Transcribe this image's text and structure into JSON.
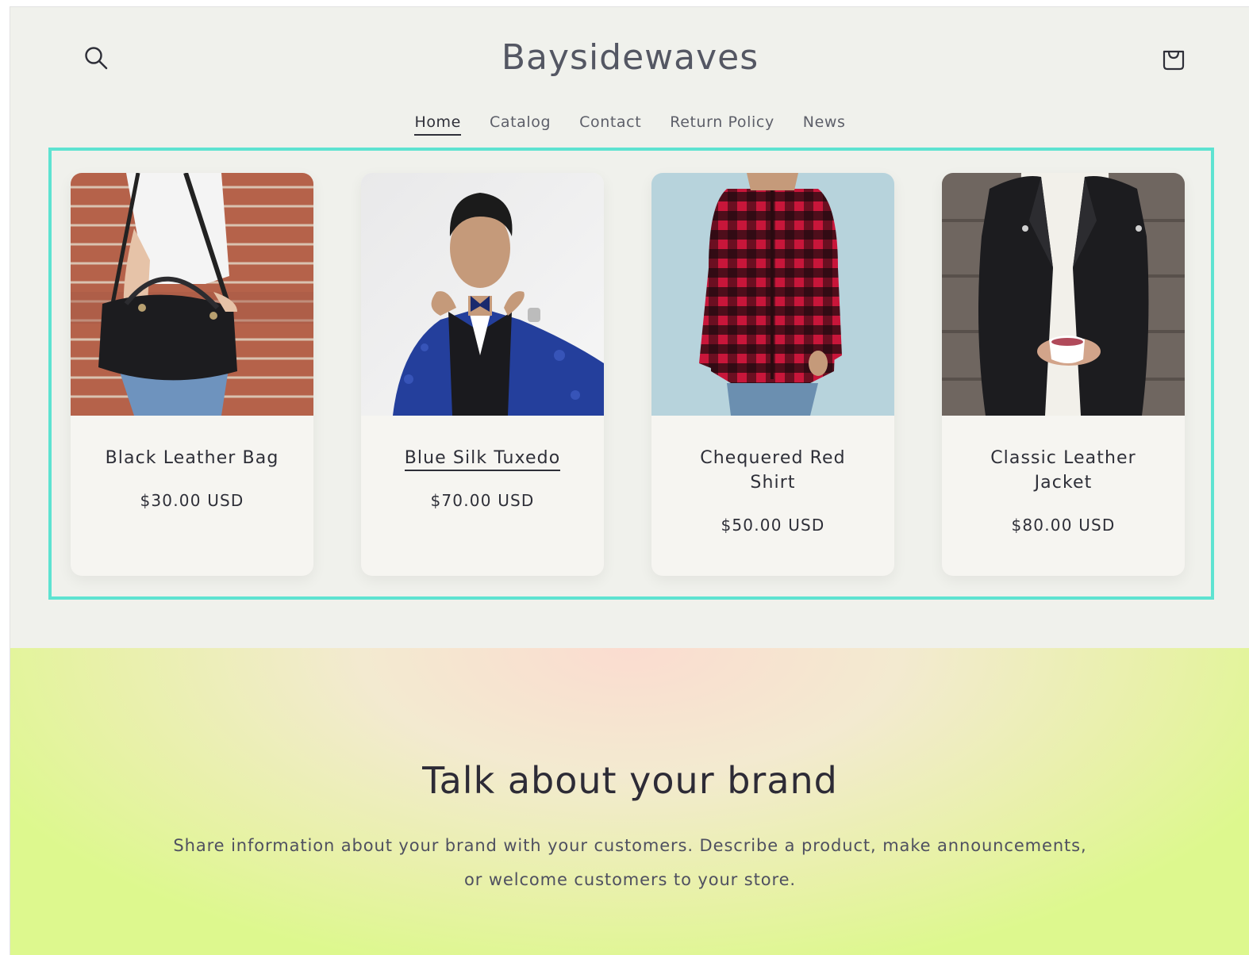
{
  "header": {
    "brand": "Baysidewaves",
    "search_icon": "search-icon",
    "cart_icon": "shopping-bag-icon"
  },
  "nav": {
    "items": [
      {
        "label": "Home",
        "active": true
      },
      {
        "label": "Catalog",
        "active": false
      },
      {
        "label": "Contact",
        "active": false
      },
      {
        "label": "Return Policy",
        "active": false
      },
      {
        "label": "News",
        "active": false
      }
    ]
  },
  "products": [
    {
      "title": "Black Leather Bag",
      "price": "$30.00 USD"
    },
    {
      "title": "Blue Silk Tuxedo",
      "price": "$70.00 USD"
    },
    {
      "title": "Chequered Red Shirt",
      "price": "$50.00 USD"
    },
    {
      "title": "Classic Leather Jacket",
      "price": "$80.00 USD"
    }
  ],
  "brand_section": {
    "heading": "Talk about your brand",
    "text": "Share information about your brand with your customers. Describe a product, make announcements, or welcome customers to your store."
  },
  "colors": {
    "grid_border": "#5ee3d1",
    "background": "#f0f1ec",
    "card": "#f6f5f1",
    "text": "#2e2f38"
  }
}
